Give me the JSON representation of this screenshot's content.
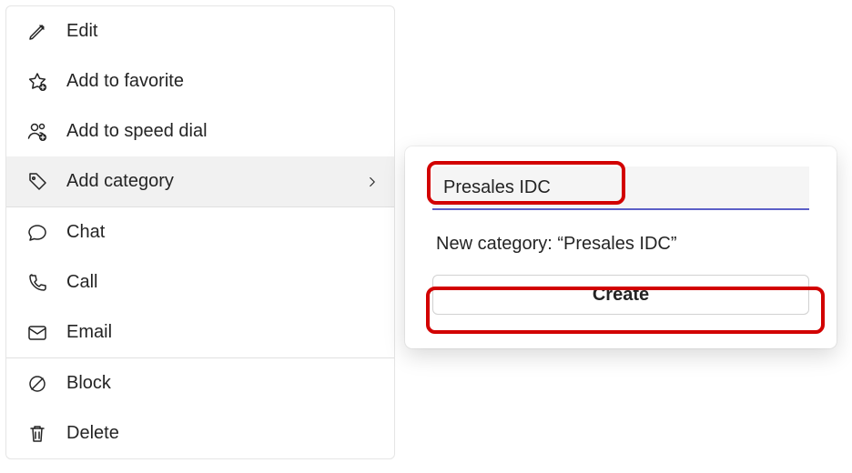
{
  "menu": {
    "items": [
      {
        "id": "edit",
        "label": "Edit",
        "icon": "pencil-icon"
      },
      {
        "id": "favorite",
        "label": "Add to favorite",
        "icon": "star-plus-icon"
      },
      {
        "id": "speed-dial",
        "label": "Add to speed dial",
        "icon": "person-plus-icon"
      },
      {
        "id": "add-category",
        "label": "Add category",
        "icon": "tag-icon",
        "submenu": true,
        "highlight": true
      },
      {
        "id": "chat",
        "label": "Chat",
        "icon": "chat-icon"
      },
      {
        "id": "call",
        "label": "Call",
        "icon": "phone-icon"
      },
      {
        "id": "email",
        "label": "Email",
        "icon": "mail-icon"
      },
      {
        "id": "block",
        "label": "Block",
        "icon": "block-icon"
      },
      {
        "id": "delete",
        "label": "Delete",
        "icon": "trash-icon"
      }
    ]
  },
  "flyout": {
    "input_value": "Presales IDC",
    "suggest_prefix": "New category: ",
    "suggest_value": "“Presales IDC”",
    "create_label": "Create"
  },
  "colors": {
    "accent": "#5b5fc7",
    "annotation": "#d20000"
  }
}
